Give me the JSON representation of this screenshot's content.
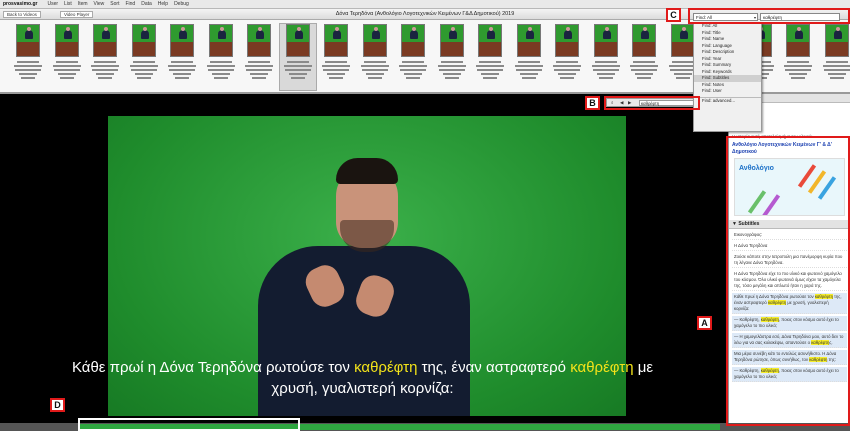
{
  "menubar": {
    "brand": "prosvasimo.gr",
    "items": [
      "User",
      "List",
      "Item",
      "View",
      "Sort",
      "Find",
      "Data",
      "Help",
      "Debug"
    ]
  },
  "titlebar": {
    "back_label": "Back to Videos",
    "player_label": "Video Player",
    "title": "Δόνα Τερηδόνα (Ανθολόγιο Λογοτεχνικών Κειμένων Γ&Δ Δημοτικού) 2019"
  },
  "find": {
    "selected_option": "Find: All",
    "query": "καθρέφτη",
    "options": [
      "Find: All",
      "Find: Title",
      "Find: Name",
      "Find: Language",
      "Find: Description",
      "Find: Year",
      "Find: Summary",
      "Find: Keywords",
      "Find: Subtitles",
      "Find: Notes",
      "Find: User",
      "Find: advanced..."
    ],
    "highlighted_option": "Find: Subtitles"
  },
  "mini_search": {
    "query": "καθρέφτη"
  },
  "markers": {
    "a": "A",
    "b": "B",
    "c": "C",
    "d": "D"
  },
  "subtitle": {
    "line1_a": "Κάθε πρωί η Δόνα Τερηδόνα ρωτούσε τον ",
    "kw1": "καθρέφτη",
    "line1_b": " της, έναν αστραφτερό ",
    "kw2": "καθρέφτη",
    "line1_c": " με",
    "line2": "χρυσή, γυαλιστερή κορνίζα:"
  },
  "sidebar": {
    "header": "Description",
    "intro": "Η ιστορία αυτή αποτελεί τμήμα του υλικού:",
    "book_title": "Ανθολόγιο Λογοτεχνικών Κειμένων Γ' & Δ' Δημοτικού",
    "book_cover_text": "Ανθολόγιο",
    "subtitles_header": "▼ Subtitles",
    "subtitle_lines": [
      "Εικονογράφος:",
      "Η Δόνα Τερηδόνα",
      "Ζούσε κάποτε στην Ιατροπολη μια πανέμορφη κυρία που τη λέγανε Δόνα Τερηδόνα.",
      "Η Δόνα Τερηδόνα είχε το πιο υλικό και φωτεινό χαμόγελο του κόσμου. Όλο υλικό φωτεινά όμως είχαν τα χαμόγελα της, τόσο μεγάλη και απλωτό ήταν η χαρά της.",
      "Κάθε πρωί η Δόνα Τερηδόνα ρωτούσε τον καθρέφτη της, έναν αστραφτερό καθρέφτη με χρυσή, γυαλιστερή κορνίζα:",
      "— Καθρέφτη, καθρέφτη, ποιος στον κόσμο αυτό έχει το χαμόγελο το πιο υλικό;",
      "— Η χαμογελάστρα εσύ, Δόνα Τερηδόνα μου, αυτό δεν το λέω για να σας κολακέψω, απαντούσε ο καθρέφτης.",
      "Μια μέρα συνέβη κάτι το εντελώς ασυνήθιστο. Η Δόνα Τερηδόνα ρώτησε, όπως συνήθως, τον καθρέφτη της:",
      "— Καθρέφτη, καθρέφτη, ποιος στον κόσμο αυτό έχει το χαμόγελο το πιο υλικό;"
    ],
    "highlight_word": "καθρέφτη"
  },
  "colors": {
    "accent_red": "#e01a1a",
    "highlight_yellow": "#f2e21a",
    "greenscreen": "#2a9e3a"
  }
}
